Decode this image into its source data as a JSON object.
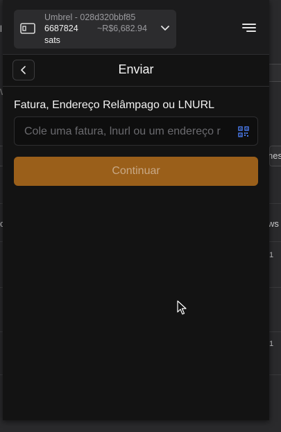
{
  "header": {
    "account_name": "Umbrel - 028d320bbf85",
    "balance": "6687824",
    "balance_unit": "sats",
    "fiat_balance": "~R$6,682.94"
  },
  "nav": {
    "title": "Enviar"
  },
  "form": {
    "label": "Fatura, Endereço Relâmpago ou LNURL",
    "placeholder": "Cole uma fatura, lnurl ou um endereço r",
    "value": "",
    "submit_label": "Continuar"
  },
  "background_fragments": [
    "l",
    "W",
    "nes",
    "c",
    "ws",
    "1",
    "1"
  ],
  "colors": {
    "popup_bg": "#131313",
    "header_bg": "#1b1b1c",
    "accent": "#9a5f1a",
    "qr_icon": "#4a7cf0"
  }
}
